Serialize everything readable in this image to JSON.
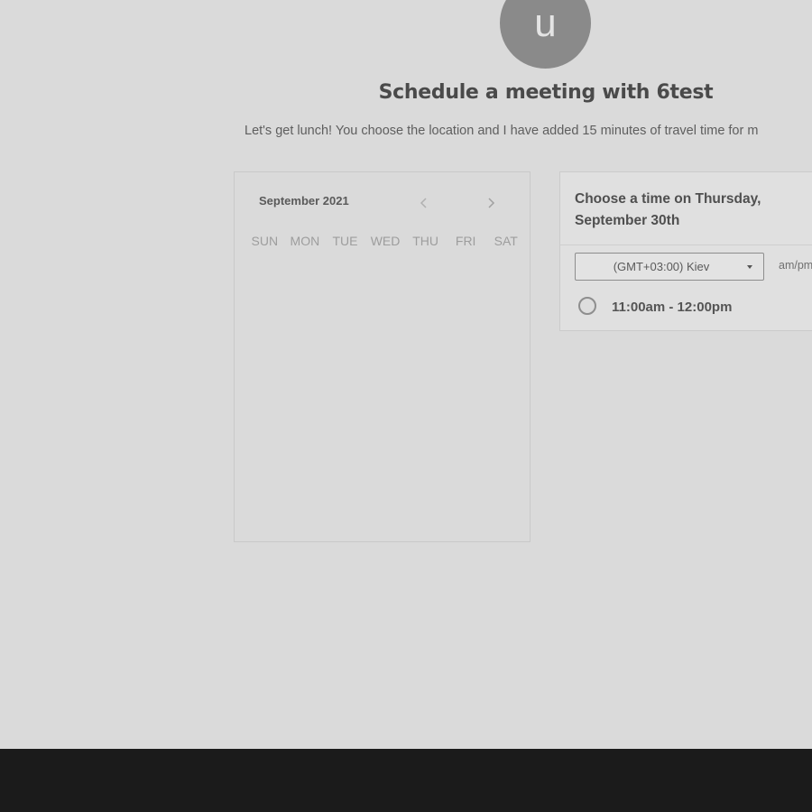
{
  "host": {
    "avatar_initial": "u"
  },
  "page": {
    "title": "Schedule a meeting with 6test",
    "description": "Let's get lunch! You choose the location and I have added 15 minutes of travel time for m"
  },
  "calendar": {
    "month_label": "September 2021",
    "prev_icon": "chevron-left-icon",
    "next_icon": "chevron-right-icon",
    "weekdays": [
      "SUN",
      "MON",
      "TUE",
      "WED",
      "THU",
      "FRI",
      "SAT"
    ]
  },
  "time_picker": {
    "heading_line1": "Choose a time on Thursday,",
    "heading_line2": "September 30th",
    "timezone": {
      "value": "(GMT+03:00) Kiev",
      "icon": "caret-down-icon"
    },
    "format_label": "am/pm",
    "slots": [
      {
        "label": "11:00am - 12:00pm",
        "selected": false
      }
    ]
  },
  "colors": {
    "background": "#dadada",
    "text_primary": "#4a4a4a",
    "text_muted": "#9d9d9d",
    "avatar": "#8a8a8a",
    "bottom_bar": "#1b1b1b"
  }
}
